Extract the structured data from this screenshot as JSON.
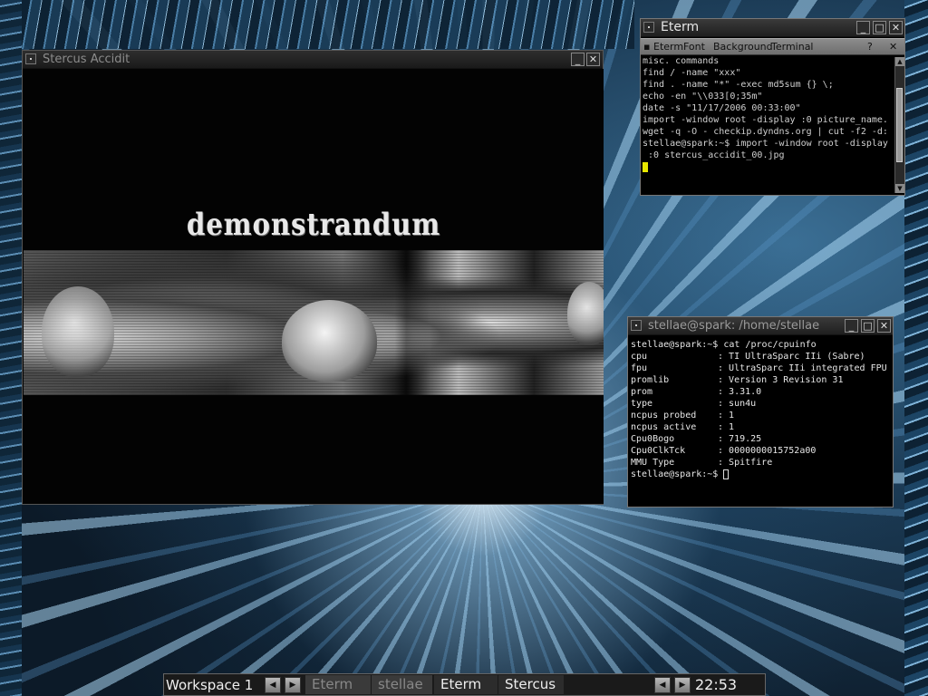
{
  "desktop": {
    "wallpaper": "abstract-blue-streaks"
  },
  "stercus_window": {
    "title": "Stercus Accidit",
    "banner_text": "demonstrandum",
    "image": "skulls-grayscale-collage"
  },
  "eterm_window": {
    "title": "Eterm",
    "menu": [
      "Eterm",
      "Font",
      "Background",
      "Terminal"
    ],
    "help_label": "?",
    "lines": [
      "misc. commands",
      "find / -name \"xxx\"",
      "find . -name \"*\" -exec md5sum {} \\;",
      "echo -en \"\\\\033[0;35m\"",
      "date -s \"11/17/2006 00:33:00\"",
      "import -window root -display :0 picture_name.",
      "wget -q -O - checkip.dyndns.org | cut -f2 -d:",
      "stellae@spark:~$ import -window root -display",
      " :0 stercus_accidit_00.jpg"
    ]
  },
  "xterm_window": {
    "title": "stellae@spark: /home/stellae",
    "prompt_command": "stellae@spark:~$ cat /proc/cpuinfo",
    "rows": [
      {
        "key": "cpu",
        "value": "TI UltraSparc IIi (Sabre)"
      },
      {
        "key": "fpu",
        "value": "UltraSparc IIi integrated FPU"
      },
      {
        "key": "promlib",
        "value": "Version 3 Revision 31"
      },
      {
        "key": "prom",
        "value": "3.31.0"
      },
      {
        "key": "type",
        "value": "sun4u"
      },
      {
        "key": "ncpus probed",
        "value": "1"
      },
      {
        "key": "ncpus active",
        "value": "1"
      },
      {
        "key": "Cpu0Bogo",
        "value": "719.25"
      },
      {
        "key": "Cpu0ClkTck",
        "value": "0000000015752a00"
      },
      {
        "key": "MMU Type",
        "value": "Spitfire"
      }
    ],
    "final_prompt": "stellae@spark:~$ "
  },
  "taskbar": {
    "workspace": "Workspace 1",
    "tasks": [
      "Eterm",
      "stellae",
      "Eterm",
      "Stercus"
    ],
    "clock": "22:53"
  },
  "colors": {
    "eterm_cursor": "#e8e800",
    "terminal_text": "#e6e6e6"
  }
}
